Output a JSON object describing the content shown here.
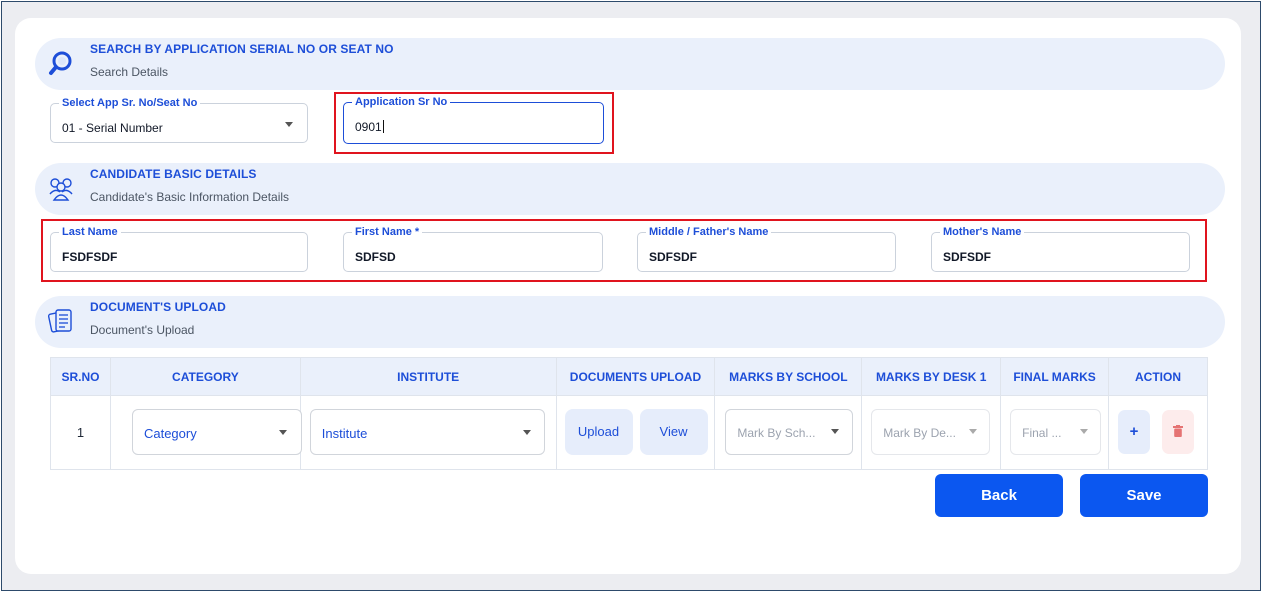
{
  "search_section": {
    "title": "SEARCH BY APPLICATION SERIAL NO OR SEAT NO",
    "subtitle": "Search Details",
    "icon": "search-icon"
  },
  "search_fields": {
    "select_label": "Select App Sr. No/Seat No",
    "select_value": "01 - Serial Number",
    "app_sr_label": "Application Sr No",
    "app_sr_value": "0901"
  },
  "candidate_section": {
    "title": "CANDIDATE BASIC DETAILS",
    "subtitle": "Candidate's Basic Information Details",
    "icon": "users-icon"
  },
  "candidate_fields": {
    "last_name_label": "Last Name",
    "last_name_value": "FSDFSDF",
    "first_name_label": "First Name *",
    "first_name_value": "SDFSD",
    "middle_name_label": "Middle / Father's Name",
    "middle_name_value": "SDFSDF",
    "mother_name_label": "Mother's Name",
    "mother_name_value": "SDFSDF"
  },
  "documents_section": {
    "title": "DOCUMENT'S UPLOAD",
    "subtitle": "Document's Upload",
    "icon": "documents-icon"
  },
  "table": {
    "headers": [
      "SR.NO",
      "CATEGORY",
      "INSTITUTE",
      "DOCUMENTS UPLOAD",
      "MARKS BY SCHOOL",
      "MARKS BY DESK 1",
      "FINAL MARKS",
      "ACTION"
    ],
    "row": {
      "sr_no": "1",
      "category": "Category",
      "institute": "Institute",
      "upload_label": "Upload",
      "view_label": "View",
      "marks_school_placeholder": "Mark By Sch...",
      "marks_desk_placeholder": "Mark By De...",
      "final_marks_placeholder": "Final ...",
      "add_symbol": "+",
      "delete_icon": "trash-icon"
    }
  },
  "buttons": {
    "back": "Back",
    "save": "Save"
  },
  "colors": {
    "accent": "#1d4ed8",
    "primary_button": "#0b57f0",
    "highlight_box": "#e0141e",
    "delete": "#e57373"
  }
}
